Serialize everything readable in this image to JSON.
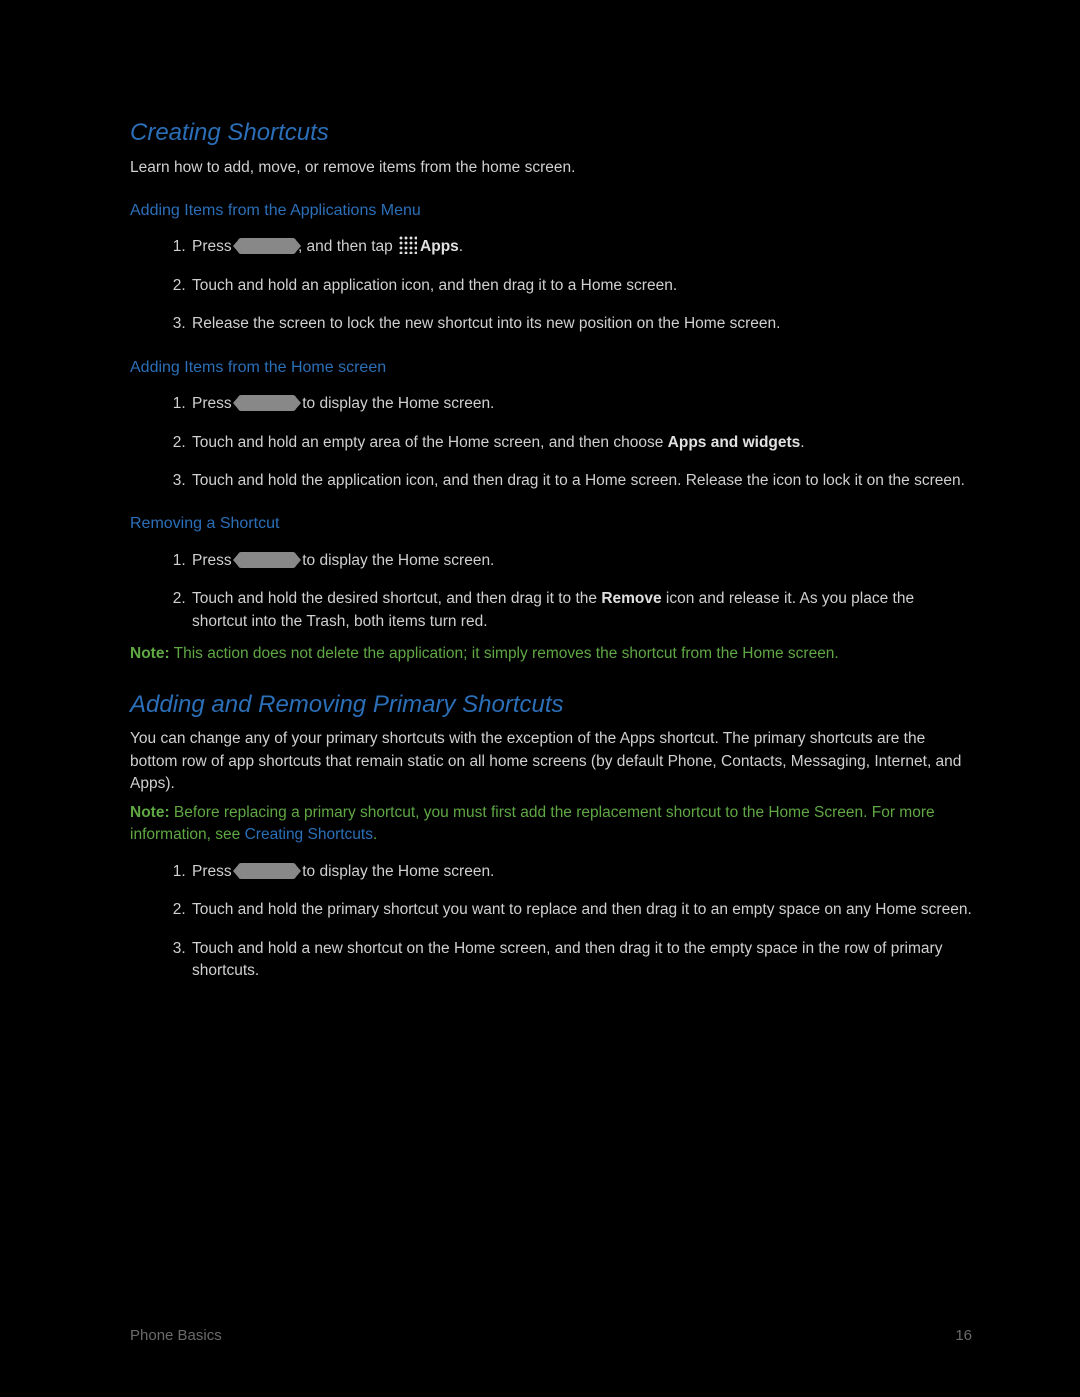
{
  "section1": {
    "title": "Creating Shortcuts",
    "intro": "Learn how to add, move, or remove items from the home screen.",
    "sub1": {
      "title": "Adding Items from the Applications Menu",
      "steps": {
        "s1a": "Press ",
        "s1b": ", and then tap ",
        "s1c_bold": "Apps",
        "s1d": ".",
        "s2": "Touch and hold an application icon, and then drag it to a Home screen.",
        "s3": "Release the screen to lock the new shortcut into its new position on the Home screen."
      }
    },
    "sub2": {
      "title": "Adding Items from the Home screen",
      "steps": {
        "s1a": "Press ",
        "s1b": " to display the Home screen.",
        "s2a": "Touch and hold an empty area of the Home screen, and then choose ",
        "s2b_bold": "Apps and widgets",
        "s2c": ".",
        "s3": "Touch and hold the application icon, and then drag it to a Home screen. Release the icon to lock it on the screen."
      }
    },
    "sub3": {
      "title": "Removing a Shortcut",
      "steps": {
        "s1a": "Press ",
        "s1b": " to display the Home screen.",
        "s2a": "Touch and hold the desired shortcut, and then drag it to the ",
        "s2b_bold": "Remove",
        "s2c": " icon and release it. As you place the shortcut into the Trash, both items turn red."
      }
    },
    "note": {
      "label": "Note:",
      "text": " This action does not delete the application; it simply removes the shortcut from the Home screen."
    }
  },
  "section2": {
    "title": "Adding and Removing Primary Shortcuts",
    "intro": "You can change any of your primary shortcuts with the exception of the Apps shortcut. The primary shortcuts are the bottom row of app shortcuts that remain static on all home screens (by default Phone, Contacts, Messaging, Internet, and Apps).",
    "note": {
      "label": "Note:",
      "text1": " Before replacing a primary shortcut, you must first add the replacement shortcut to the Home Screen. For more information, see ",
      "link": "Creating Shortcuts",
      "text2": "."
    },
    "steps": {
      "s1a": "Press ",
      "s1b": " to display the Home screen.",
      "s2": "Touch and hold the primary shortcut you want to replace and then drag it to an empty space on any Home screen.",
      "s3": "Touch and hold a new shortcut on the Home screen, and then drag it to the empty space in the row of primary shortcuts."
    }
  },
  "footer": {
    "left": "Phone Basics",
    "right": "16"
  }
}
